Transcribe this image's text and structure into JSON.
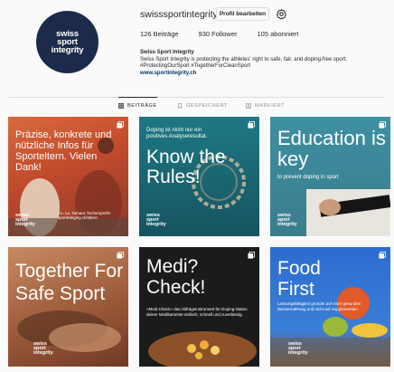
{
  "profile": {
    "avatar_lines": [
      "swiss",
      "sport",
      "integrity"
    ],
    "username": "swisssportintegrity",
    "edit_button": "Profil bearbeiten",
    "stats": {
      "posts": "126 Beiträge",
      "followers": "930 Follower",
      "following": "105 abonniert"
    },
    "bio_name": "Swiss Sport Integrity",
    "bio_line1": "Swiss Sport Integrity is protecting the athletes' right to safe, fair, and doping-free sport.",
    "bio_line2": "#ProtectingOurSport #TogetherForCleanSport",
    "bio_link": "www.sportintegrity.ch"
  },
  "tabs": [
    {
      "label": "BEITRÄGE",
      "active": true
    },
    {
      "label": "GESPEICHERT",
      "active": false
    },
    {
      "label": "MARKIERT",
      "active": false
    }
  ],
  "posts": [
    {
      "headline": "Präzise, konkrete und nützliche Infos für Sporteltern. Vielen Dank!",
      "small": "Lic. iur. Tamara Tschümperlin · sportintegrity.ch/eltern",
      "logo": [
        "swiss",
        "sport",
        "integrity"
      ],
      "bg": "#c3542f"
    },
    {
      "intro": "Doping ist nicht nur ein positives Analyseresultat.",
      "headline": "Know the Rules!",
      "logo": [
        "swiss",
        "sport",
        "integrity"
      ],
      "bg": "#1f6b76"
    },
    {
      "headline": "Education is key",
      "small": "to prevent doping in sport",
      "logo": [
        "swiss",
        "sport",
        "integrity"
      ],
      "bg": "#3d8ea0"
    },
    {
      "headline": "Together For Safe Sport",
      "logo": [
        "swiss",
        "sport",
        "integrity"
      ],
      "bg": "#b8714a"
    },
    {
      "headline": "Medi? Check!",
      "small": "«Medi-Check» das Abfrageinstrument für Doping-Status deiner Medikamente einfach, schnell und zuverlässig.",
      "logo": [],
      "bg": "#1a1a1a"
    },
    {
      "headline": "Food First",
      "small": "Leistungsfähigkeit gründet auf einer gesunden Basisernährung und nicht auf Supplementen.",
      "logo": [
        "swiss",
        "sport",
        "integrity"
      ],
      "bg": "#2d6cd0"
    }
  ]
}
